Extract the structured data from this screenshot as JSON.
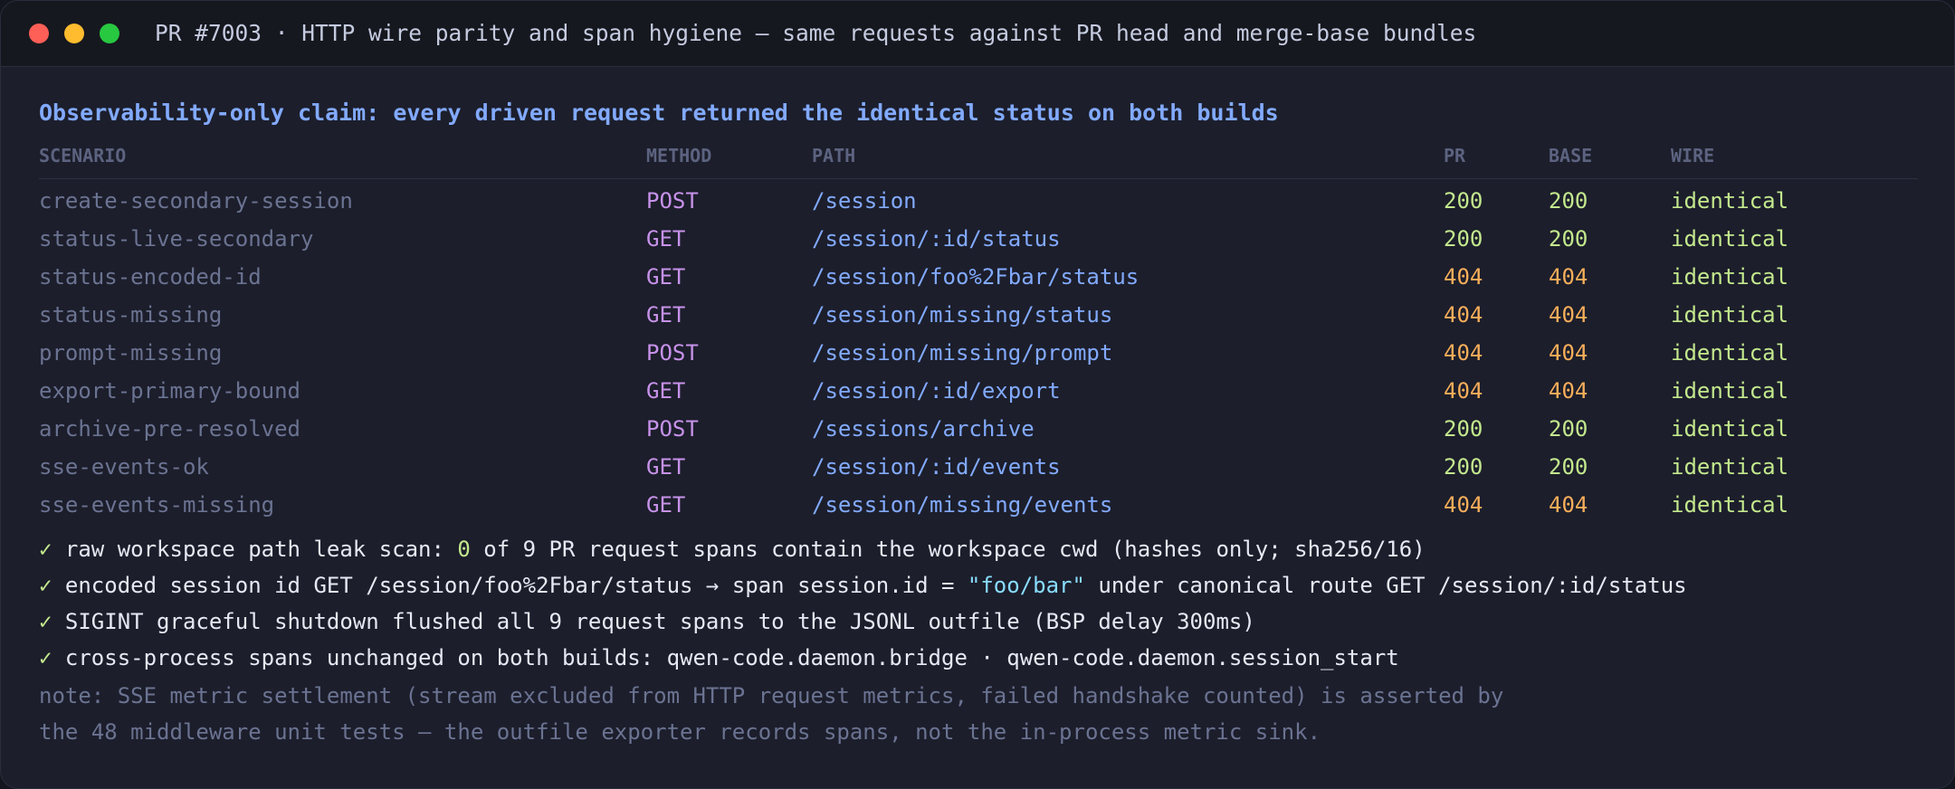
{
  "window": {
    "title": "PR #7003 · HTTP wire parity and span hygiene — same requests against PR head and merge-base bundles"
  },
  "heading": "Observability-only claim: every driven request returned the identical status on both builds",
  "table": {
    "headers": {
      "scenario": "SCENARIO",
      "method": "METHOD",
      "path": "PATH",
      "pr": "PR",
      "base": "BASE",
      "wire": "WIRE"
    },
    "rows": [
      {
        "scenario": "create-secondary-session",
        "method": "POST",
        "path": "/session",
        "pr": "200",
        "base": "200",
        "wire": "identical"
      },
      {
        "scenario": "status-live-secondary",
        "method": "GET",
        "path": "/session/:id/status",
        "pr": "200",
        "base": "200",
        "wire": "identical"
      },
      {
        "scenario": "status-encoded-id",
        "method": "GET",
        "path": "/session/foo%2Fbar/status",
        "pr": "404",
        "base": "404",
        "wire": "identical"
      },
      {
        "scenario": "status-missing",
        "method": "GET",
        "path": "/session/missing/status",
        "pr": "404",
        "base": "404",
        "wire": "identical"
      },
      {
        "scenario": "prompt-missing",
        "method": "POST",
        "path": "/session/missing/prompt",
        "pr": "404",
        "base": "404",
        "wire": "identical"
      },
      {
        "scenario": "export-primary-bound",
        "method": "GET",
        "path": "/session/:id/export",
        "pr": "404",
        "base": "404",
        "wire": "identical"
      },
      {
        "scenario": "archive-pre-resolved",
        "method": "POST",
        "path": "/sessions/archive",
        "pr": "200",
        "base": "200",
        "wire": "identical"
      },
      {
        "scenario": "sse-events-ok",
        "method": "GET",
        "path": "/session/:id/events",
        "pr": "200",
        "base": "200",
        "wire": "identical"
      },
      {
        "scenario": "sse-events-missing",
        "method": "GET",
        "path": "/session/missing/events",
        "pr": "404",
        "base": "404",
        "wire": "identical"
      }
    ]
  },
  "checks": {
    "mark": "✓",
    "leak_scan": {
      "pre": "raw workspace path leak scan: ",
      "count": "0",
      "post": " of 9 PR request spans contain the workspace cwd (hashes only; sha256/16)"
    },
    "encoded": {
      "pre": "encoded session id GET /session/foo%2Fbar/status → span session.id = ",
      "value": "\"foo/bar\"",
      "post": " under canonical route GET /session/:id/status"
    },
    "sigint": "SIGINT graceful shutdown flushed all 9 request spans to the JSONL outfile (BSP delay 300ms)",
    "cross_process": "cross-process spans unchanged on both builds: qwen-code.daemon.bridge · qwen-code.daemon.session_start"
  },
  "note": {
    "line1": "note: SSE metric settlement (stream excluded from HTTP request metrics, failed handshake counted) is asserted by",
    "line2": "the 48 middleware unit tests — the outfile exporter records spans, not the in-process metric sink."
  },
  "colors": {
    "ok_status": "#c3e88d",
    "not_found_status": "#f8ae5a",
    "method": "#c792ea",
    "path": "#82aaff"
  }
}
